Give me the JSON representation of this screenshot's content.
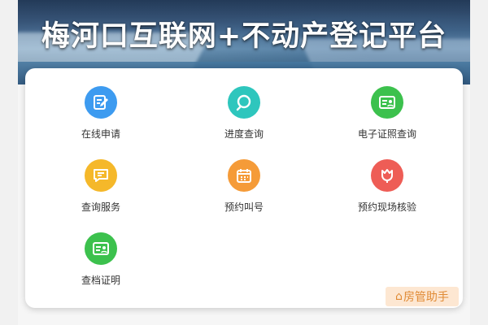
{
  "banner": {
    "title": "梅河口互联网+不动产登记平台"
  },
  "services": [
    {
      "label": "在线申请",
      "icon": "edit-form-icon",
      "color": "#3d9bf0"
    },
    {
      "label": "进度查询",
      "icon": "search-icon",
      "color": "#2ec6bd"
    },
    {
      "label": "电子证照查询",
      "icon": "id-card-icon",
      "color": "#3cc14d"
    },
    {
      "label": "查询服务",
      "icon": "message-icon",
      "color": "#f5b82a"
    },
    {
      "label": "预约叫号",
      "icon": "calendar-icon",
      "color": "#f59b38"
    },
    {
      "label": "预约现场核验",
      "icon": "tulip-icon",
      "color": "#ee5d56"
    },
    {
      "label": "查档证明",
      "icon": "id-card-icon",
      "color": "#3cc14d"
    }
  ],
  "watermark": {
    "text": "房管助手"
  }
}
